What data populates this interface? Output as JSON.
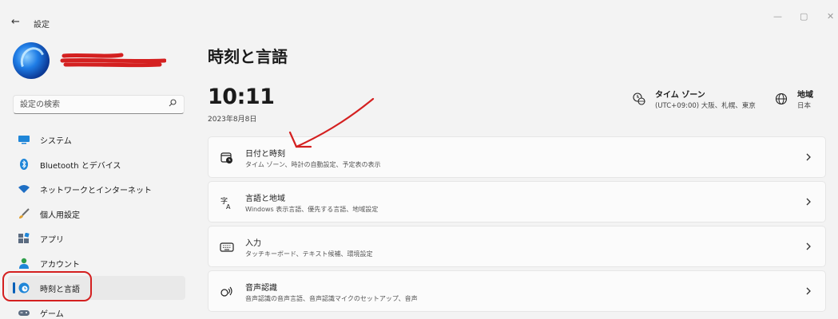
{
  "titlebar": {
    "back_icon": "←",
    "app_title": "設定",
    "minimize": "—",
    "maximize": "▢",
    "close": "✕"
  },
  "search": {
    "placeholder": "設定の検索"
  },
  "sidebar": {
    "items": [
      {
        "label": "システム",
        "icon": "monitor-icon"
      },
      {
        "label": "Bluetooth とデバイス",
        "icon": "bluetooth-icon"
      },
      {
        "label": "ネットワークとインターネット",
        "icon": "wifi-icon"
      },
      {
        "label": "個人用設定",
        "icon": "brush-icon"
      },
      {
        "label": "アプリ",
        "icon": "apps-icon"
      },
      {
        "label": "アカウント",
        "icon": "person-icon"
      },
      {
        "label": "時刻と言語",
        "icon": "clock-globe-icon",
        "active": true
      },
      {
        "label": "ゲーム",
        "icon": "gamepad-icon"
      }
    ]
  },
  "main": {
    "title": "時刻と言語",
    "time": "10:11",
    "date": "2023年8月8日",
    "timezone": {
      "title": "タイム ゾーン",
      "value": "(UTC+09:00) 大阪、札幌、東京"
    },
    "region": {
      "title": "地域",
      "value": "日本"
    },
    "cards": [
      {
        "title": "日付と時刻",
        "subtitle": "タイム ゾーン、時計の自動設定、予定表の表示",
        "icon": "calendar-clock-icon"
      },
      {
        "title": "言語と地域",
        "subtitle": "Windows 表示言語、優先する言語、地域設定",
        "icon": "language-icon"
      },
      {
        "title": "入力",
        "subtitle": "タッチキーボード、テキスト候補、環境設定",
        "icon": "keyboard-icon"
      },
      {
        "title": "音声認識",
        "subtitle": "音声認識の音声言語、音声認識マイクのセットアップ、音声",
        "icon": "speech-icon"
      }
    ]
  },
  "colors": {
    "accent": "#005fb8",
    "annotation": "#d42020",
    "background": "#f3f3f3",
    "card": "#fbfbfb"
  }
}
